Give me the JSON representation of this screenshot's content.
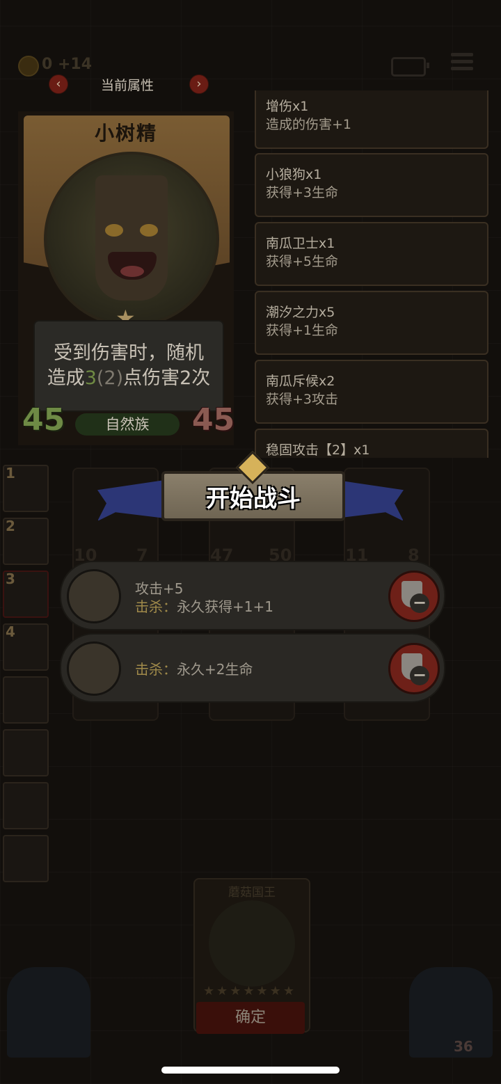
{
  "top_bar": {
    "coin_text": "0 +14",
    "icons": [
      "coin-icon",
      "battery-icon",
      "menu-icon"
    ]
  },
  "attribute_header": {
    "title": "当前属性",
    "prev_label": "‹",
    "next_label": "›"
  },
  "hero_card": {
    "name": "小树精",
    "description_line1": "受到伤害时，随机",
    "description_line2_prefix": "造成",
    "description_value": "3",
    "description_base": "(2)",
    "description_line2_suffix": "点伤害2次",
    "tribe": "自然族",
    "attack": "45",
    "health": "45"
  },
  "buff_list": [
    {
      "name": "增伤x1",
      "desc": "造成的伤害+1"
    },
    {
      "name": "小狼狗x1",
      "desc": "获得+3生命"
    },
    {
      "name": "南瓜卫士x1",
      "desc": "获得+5生命"
    },
    {
      "name": "潮汐之力x5",
      "desc": "获得+1生命"
    },
    {
      "name": "南瓜斥候x2",
      "desc": "获得+3攻击"
    },
    {
      "name": "稳固攻击【2】x1",
      "desc": ""
    }
  ],
  "left_slots": [
    "1",
    "2",
    "3",
    "4",
    "",
    "",
    "",
    ""
  ],
  "battle_banner": {
    "label": "开始战斗"
  },
  "dim_board_numbers": [
    "10",
    "7",
    "47",
    "50",
    "11",
    "8"
  ],
  "rewards": [
    {
      "main": "攻击+5",
      "kill_label": "击杀：",
      "kill_value": "永久获得+1+1"
    },
    {
      "main": "",
      "kill_label": "击杀：",
      "kill_value": "永久+2生命"
    }
  ],
  "bottom_card": {
    "title": "蘑菇国王",
    "stars": "★★★★★★★"
  },
  "confirm_button": "确定",
  "corner_badge": "36",
  "colors": {
    "accent_green": "#6f8a43",
    "accent_red": "#6e2018",
    "banner_blue": "#2c3676"
  }
}
